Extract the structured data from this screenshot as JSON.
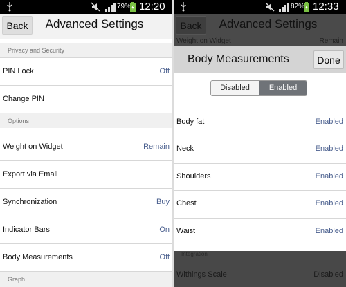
{
  "left": {
    "status": {
      "battery_pct": "79%",
      "time": "12:20"
    },
    "back_label": "Back",
    "title": "Advanced Settings",
    "sections": [
      {
        "header": "Privacy and Security"
      },
      {
        "header": "Options"
      },
      {
        "header": "Graph"
      }
    ],
    "rows": [
      {
        "label": "PIN Lock",
        "value": "Off"
      },
      {
        "label": "Change PIN",
        "value": ""
      },
      {
        "label": "Weight on Widget",
        "value": "Remain"
      },
      {
        "label": "Export via Email",
        "value": ""
      },
      {
        "label": "Synchronization",
        "value": "Buy"
      },
      {
        "label": "Indicator Bars",
        "value": "On"
      },
      {
        "label": "Body Measurements",
        "value": "Off"
      }
    ]
  },
  "right": {
    "status": {
      "battery_pct": "82%",
      "time": "12:33"
    },
    "back_label": "Back",
    "title": "Advanced Settings",
    "behind_row": {
      "label": "Weight on Widget",
      "value": "Remain"
    },
    "behind_bottom_header": "Integration",
    "behind_bottom_row": {
      "label": "Withings Scale",
      "value": "Disabled"
    },
    "sheet": {
      "title": "Body Measurements",
      "done_label": "Done",
      "toggle": {
        "off_label": "Disabled",
        "on_label": "Enabled",
        "selected": "Enabled"
      },
      "rows": [
        {
          "label": "Body fat",
          "value": "Enabled"
        },
        {
          "label": "Neck",
          "value": "Enabled"
        },
        {
          "label": "Shoulders",
          "value": "Enabled"
        },
        {
          "label": "Chest",
          "value": "Enabled"
        },
        {
          "label": "Waist",
          "value": "Enabled"
        }
      ]
    }
  },
  "colors": {
    "value_blue": "#4a5f8e",
    "status_bar": "#000000",
    "battery_green": "#7ac143"
  },
  "icons": [
    "usb-icon",
    "mute-icon",
    "signal-icon",
    "battery-icon"
  ]
}
